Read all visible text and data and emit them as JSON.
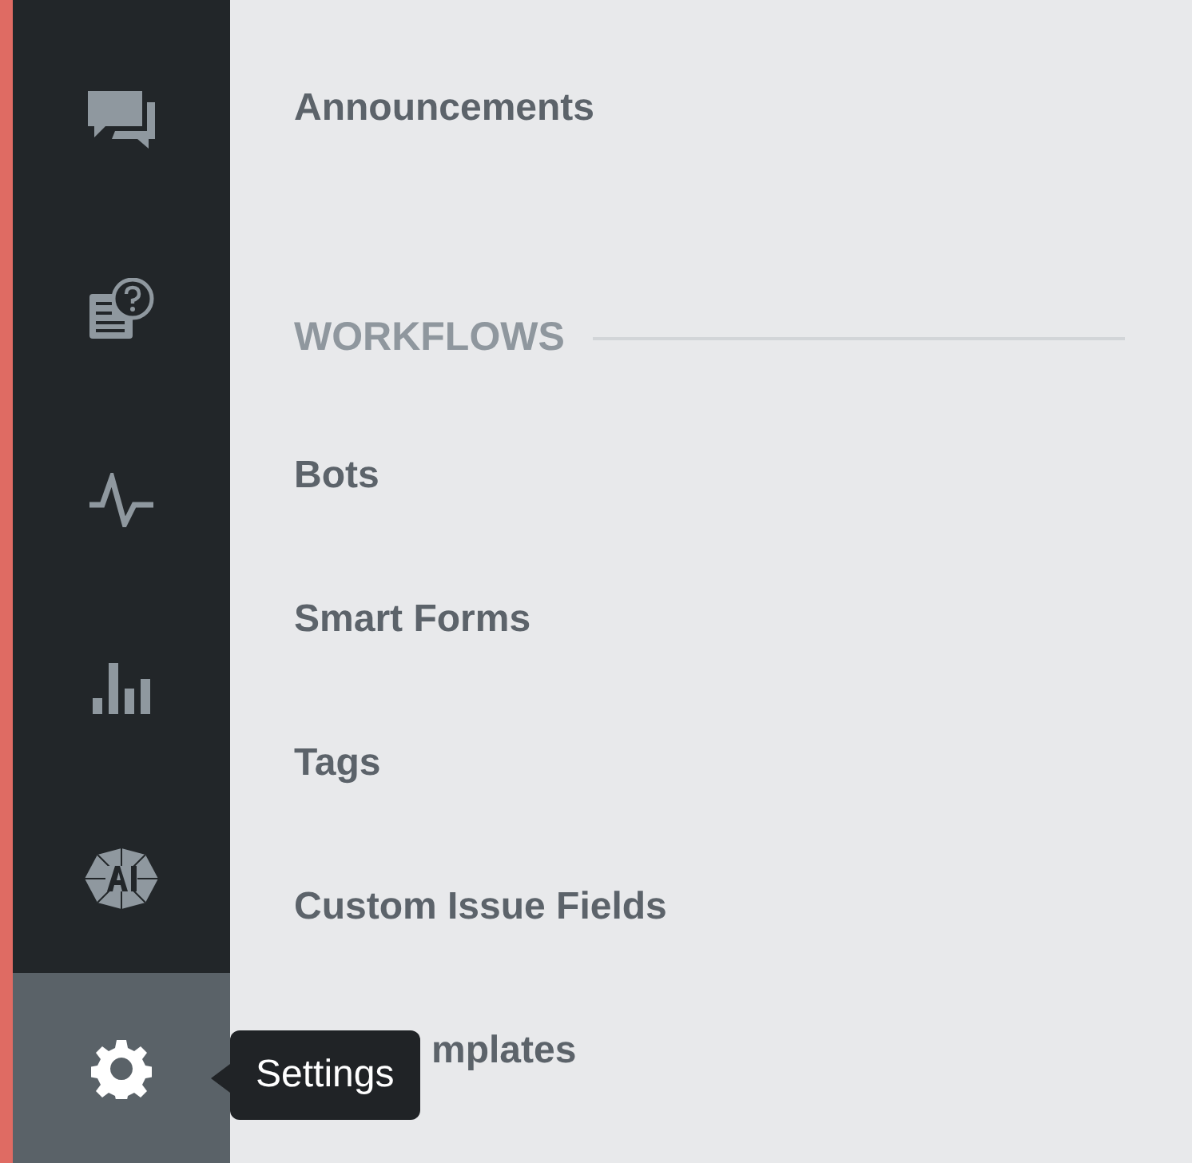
{
  "sidebar": {
    "items": [
      {
        "selected": false
      },
      {
        "selected": false
      },
      {
        "selected": false
      },
      {
        "selected": false
      },
      {
        "selected": false
      },
      {
        "selected": true
      }
    ]
  },
  "tooltip": {
    "text": "Settings"
  },
  "main": {
    "items": [
      {
        "kind": "link",
        "label": "Announcements"
      },
      {
        "kind": "heading",
        "label": "WORKFLOWS"
      },
      {
        "kind": "link",
        "label": "Bots"
      },
      {
        "kind": "link",
        "label": "Smart Forms"
      },
      {
        "kind": "link",
        "label": "Tags"
      },
      {
        "kind": "link",
        "label": "Custom Issue Fields"
      },
      {
        "kind": "covered_link",
        "label": "mplates"
      }
    ]
  }
}
